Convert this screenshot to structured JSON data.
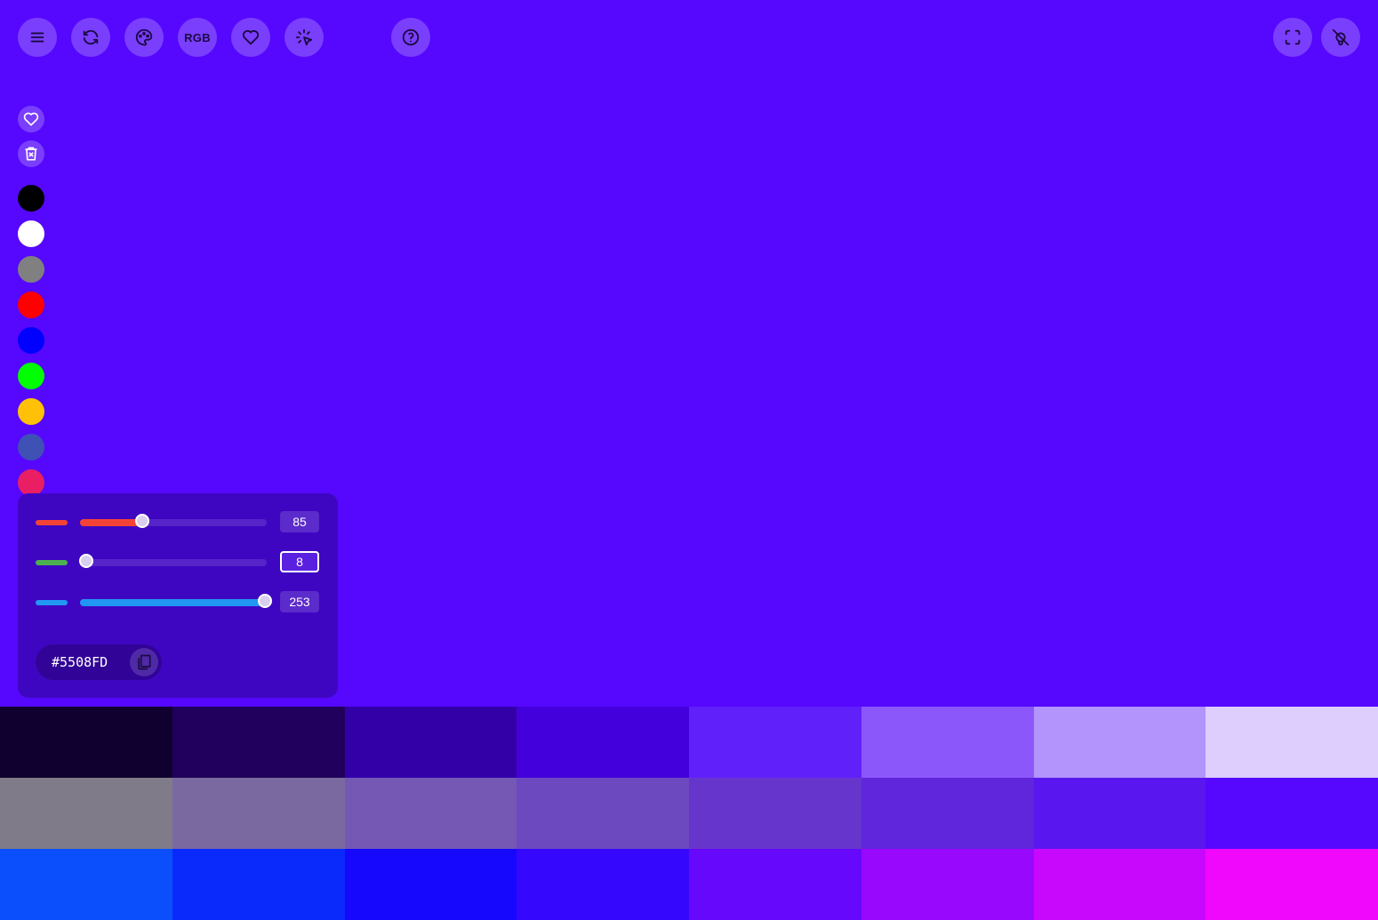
{
  "toolbar": {
    "buttons": [
      {
        "name": "menu-icon"
      },
      {
        "name": "refresh-icon"
      },
      {
        "name": "palette-icon"
      },
      {
        "name": "rgb-mode",
        "label": "RGB"
      },
      {
        "name": "heart-icon"
      },
      {
        "name": "pointer-icon"
      },
      {
        "name": "help-icon"
      },
      {
        "name": "fullscreen-icon"
      },
      {
        "name": "bulb-off-icon"
      }
    ],
    "rgb_label": "RGB"
  },
  "sidebar": {
    "favorite_icon": "heart-plus-icon",
    "delete_icon": "trash-x-icon",
    "swatches": [
      "#000000",
      "#FFFFFF",
      "#808080",
      "#FF0000",
      "#0000FF",
      "#00FF00",
      "#FFC107",
      "#3F51B5",
      "#E91E63"
    ]
  },
  "picker": {
    "red": {
      "value": "85",
      "fraction": 0.333,
      "color": "#F44336"
    },
    "green": {
      "value": "8",
      "fraction": 0.031,
      "color": "#4CAF50"
    },
    "blue": {
      "value": "253",
      "fraction": 0.992,
      "color": "#2196F3"
    },
    "hex": "#5508FD"
  },
  "background_color": "#5508FD",
  "shades": {
    "rows": [
      [
        "#100030",
        "#20005C",
        "#3300A8",
        "#4400DC",
        "#6020FA",
        "#8B57FB",
        "#B393FC",
        "#DDCEFD"
      ],
      [
        "#807B88",
        "#7A69A0",
        "#7458B4",
        "#6C49BF",
        "#6636CC",
        "#5F26DC",
        "#5916EE",
        "#5508FD"
      ],
      [
        "#0A4EFC",
        "#0A2AFC",
        "#1508FC",
        "#3508FD",
        "#6508FC",
        "#9808FD",
        "#C808FC",
        "#F008FC"
      ]
    ]
  }
}
